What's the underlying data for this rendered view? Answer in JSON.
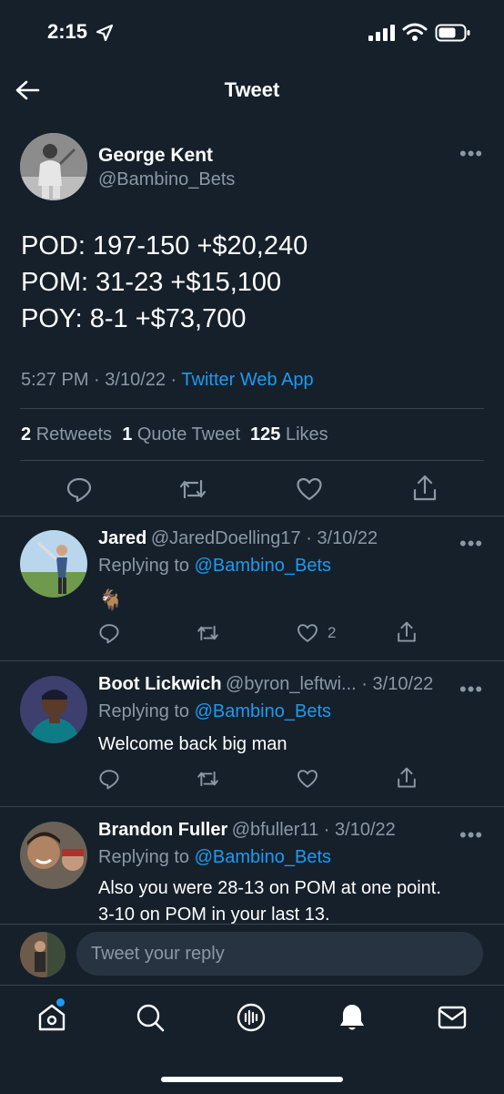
{
  "status_bar": {
    "time": "2:15"
  },
  "header": {
    "title": "Tweet"
  },
  "tweet": {
    "author_name": "George Kent",
    "handle": "@Bambino_Bets",
    "lines": [
      "POD: 197-150 +$20,240",
      "POM: 31-23 +$15,100",
      "POY: 8-1 +$73,700"
    ],
    "time": "5:27 PM",
    "date": "3/10/22",
    "source": "Twitter Web App",
    "retweets": "2",
    "retweets_label": "Retweets",
    "quotes": "1",
    "quotes_label": "Quote Tweet",
    "likes": "125",
    "likes_label": "Likes"
  },
  "replies": [
    {
      "name": "Jared",
      "handle": "@JaredDoelling17",
      "date": "3/10/22",
      "replying_label": "Replying to",
      "replying_to": "@Bambino_Bets",
      "text": "🐐",
      "likes": "2"
    },
    {
      "name": "Boot Lickwich",
      "handle": "@byron_leftwi...",
      "date": "3/10/22",
      "replying_label": "Replying to",
      "replying_to": "@Bambino_Bets",
      "text": "Welcome back big man",
      "likes": ""
    },
    {
      "name": "Brandon Fuller",
      "handle": "@bfuller11",
      "date": "3/10/22",
      "replying_label": "Replying to",
      "replying_to": "@Bambino_Bets",
      "text_line1": "Also you were 28-13 on POM at one point.",
      "text_line2": "3-10 on POM in your last 13."
    }
  ],
  "compose": {
    "placeholder": "Tweet your reply"
  },
  "colors": {
    "background": "#15202b",
    "accent": "#1d9bf0",
    "muted": "#8b98a5",
    "divider": "#38444d"
  }
}
